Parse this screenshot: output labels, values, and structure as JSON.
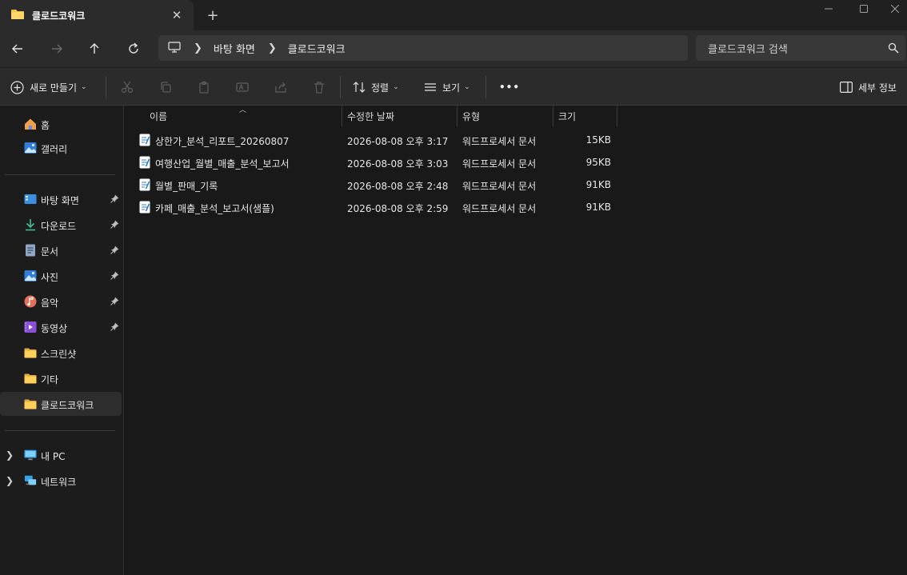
{
  "tab": {
    "title": "클로드코워크"
  },
  "breadcrumb": {
    "items": [
      "바탕 화면",
      "클로드코워크"
    ]
  },
  "search": {
    "placeholder": "클로드코워크 검색"
  },
  "commands": {
    "new_label": "새로 만들기",
    "sort_label": "정렬",
    "view_label": "보기",
    "more_label": "•••",
    "details_label": "세부 정보"
  },
  "sidebar": {
    "top": [
      {
        "label": "홈",
        "icon": "home-icon"
      },
      {
        "label": "갤러리",
        "icon": "gallery-icon"
      }
    ],
    "quick": [
      {
        "label": "바탕 화면",
        "icon": "desktop-icon",
        "pinned": true
      },
      {
        "label": "다운로드",
        "icon": "download-icon",
        "pinned": true
      },
      {
        "label": "문서",
        "icon": "documents-icon",
        "pinned": true
      },
      {
        "label": "사진",
        "icon": "pictures-icon",
        "pinned": true
      },
      {
        "label": "음악",
        "icon": "music-icon",
        "pinned": true
      },
      {
        "label": "동영상",
        "icon": "videos-icon",
        "pinned": true
      },
      {
        "label": "스크린샷",
        "icon": "folder-icon",
        "pinned": false
      },
      {
        "label": "기타",
        "icon": "folder-icon",
        "pinned": false
      },
      {
        "label": "클로드코워크",
        "icon": "folder-icon",
        "pinned": false,
        "selected": true
      }
    ],
    "bottom": [
      {
        "label": "내 PC",
        "icon": "pc-icon"
      },
      {
        "label": "네트워크",
        "icon": "network-icon"
      }
    ]
  },
  "columns": {
    "name": "이름",
    "modified": "수정한 날짜",
    "type": "유형",
    "size": "크기"
  },
  "files": [
    {
      "name": "상한가_분석_리포트_20260807",
      "modified": "2026-08-08 오후 3:17",
      "type": "워드프로세서 문서",
      "size": "15KB"
    },
    {
      "name": "여행산업_월별_매출_분석_보고서",
      "modified": "2026-08-08 오후 3:03",
      "type": "워드프로세서 문서",
      "size": "95KB"
    },
    {
      "name": "월별_판매_기록",
      "modified": "2026-08-08 오후 2:48",
      "type": "워드프로세서 문서",
      "size": "91KB"
    },
    {
      "name": "카페_매출_분석_보고서(샘플)",
      "modified": "2026-08-08 오후 2:59",
      "type": "워드프로세서 문서",
      "size": "91KB"
    }
  ],
  "colors": {
    "accent": "#4cc2ff",
    "folder": "#f4c04e",
    "bg": "#191919"
  }
}
